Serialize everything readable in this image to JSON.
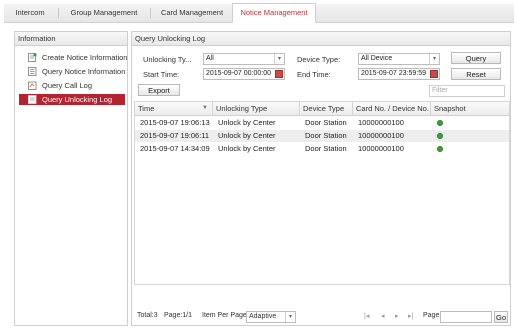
{
  "tabs": [
    {
      "label": "Intercom",
      "active": false
    },
    {
      "label": "Group Management",
      "active": false
    },
    {
      "label": "Card Management",
      "active": false
    },
    {
      "label": "Notice Management",
      "active": true
    }
  ],
  "sidebar": {
    "title": "Information",
    "items": [
      {
        "label": "Create Notice Information",
        "icon": "create-notice-icon",
        "active": false
      },
      {
        "label": "Query Notice Information",
        "icon": "query-notice-icon",
        "active": false
      },
      {
        "label": "Query Call Log",
        "icon": "call-log-icon",
        "active": false
      },
      {
        "label": "Query Unlocking Log",
        "icon": "unlock-log-icon",
        "active": true
      }
    ]
  },
  "main": {
    "title": "Query Unlocking Log",
    "form": {
      "unlocking_type_label": "Unlocking Ty...",
      "unlocking_type_value": "All",
      "device_type_label": "Device Type:",
      "device_type_value": "All Device",
      "start_time_label": "Start Time:",
      "start_time_value": "2015-09-07 00:00:00",
      "end_time_label": "End Time:",
      "end_time_value": "2015-09-07 23:59:59",
      "query_button": "Query",
      "reset_button": "Reset",
      "export_button": "Export",
      "filter_placeholder": "Filter"
    },
    "table": {
      "columns": [
        "Time",
        "Unlocking Type",
        "Device Type",
        "Card No. / Device No.",
        "Snapshot"
      ],
      "rows": [
        {
          "time": "2015-09-07 19:06:13",
          "type": "Unlock by Center",
          "device": "Door Station",
          "card": "10000000100",
          "snapshot": "snapshot-icon"
        },
        {
          "time": "2015-09-07 19:06:11",
          "type": "Unlock by Center",
          "device": "Door Station",
          "card": "10000000100",
          "snapshot": "snapshot-icon"
        },
        {
          "time": "2015-09-07 14:34:09",
          "type": "Unlock by Center",
          "device": "Door Station",
          "card": "10000000100",
          "snapshot": "snapshot-icon"
        }
      ]
    },
    "footer": {
      "total": "Total:3",
      "page": "Page:1/1",
      "per_page_label": "Item Per Page:",
      "per_page_value": "Adaptive",
      "page_label": "Page",
      "go_button": "Go"
    }
  },
  "colors": {
    "accent": "#b4232f",
    "active_tab_text": "#c0303a",
    "snapshot_ok": "#3aa33a"
  }
}
